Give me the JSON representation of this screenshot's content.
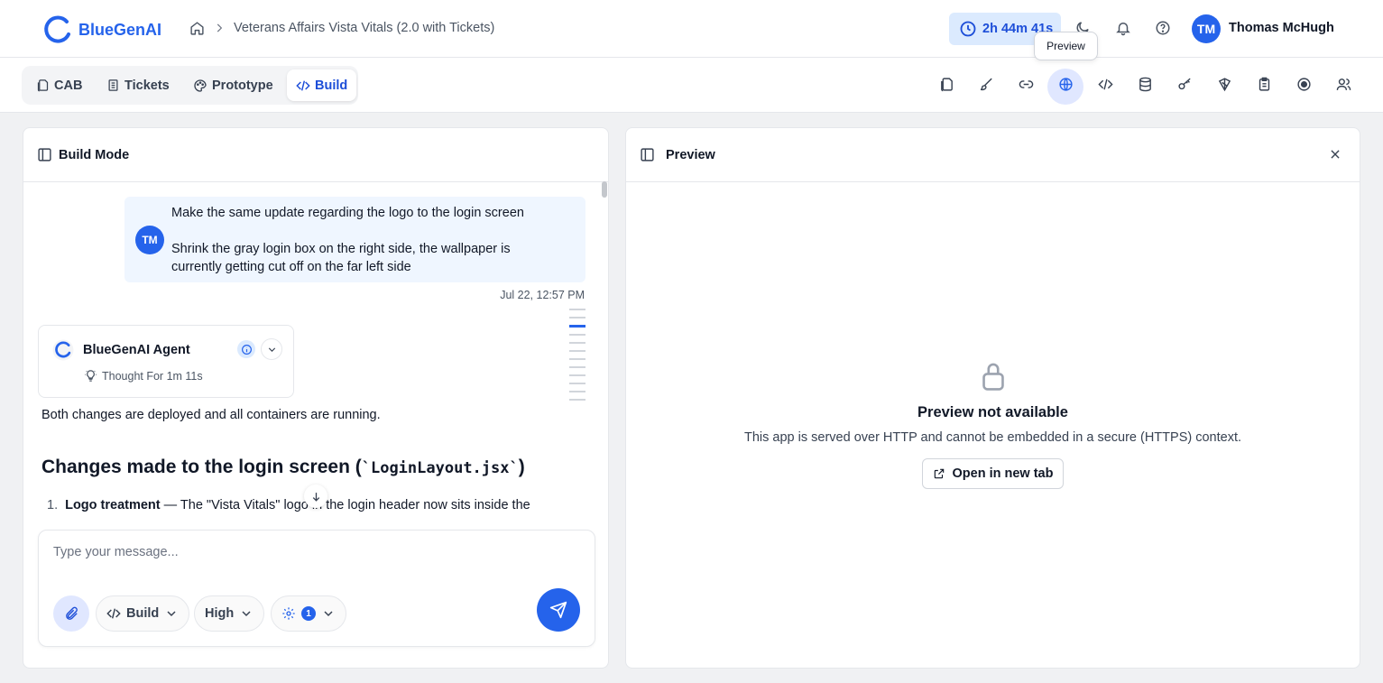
{
  "header": {
    "logo_text": "BlueGenAI",
    "breadcrumb_title": "Veterans Affairs Vista Vitals (2.0 with Tickets)",
    "timer": "2h 44m 41s",
    "tooltip": "Preview",
    "user_initials": "TM",
    "user_name": "Thomas McHugh"
  },
  "modes": {
    "cab": "CAB",
    "tickets": "Tickets",
    "prototype": "Prototype",
    "build": "Build",
    "active": "Build"
  },
  "toolbar_icons": [
    "document-icon",
    "brush-icon",
    "link-icon",
    "globe-icon",
    "code-icon",
    "database-icon",
    "key-icon",
    "shield-icon",
    "clipboard-icon",
    "record-icon",
    "users-icon"
  ],
  "left_panel": {
    "title": "Build Mode",
    "user_message": {
      "initials": "TM",
      "line1": "Make the same update regarding the logo to the login screen",
      "line2": "Shrink the gray login box on the right side, the wallpaper is",
      "line3": "currently getting cut off on the far left side",
      "timestamp": "Jul 22, 12:57 PM"
    },
    "agent": {
      "name": "BlueGenAI Agent",
      "thought": "Thought For 1m 11s"
    },
    "response": {
      "text": "Both changes are deployed and all containers are running.",
      "heading_prefix": "Changes made to the login screen (",
      "heading_code": "`LoginLayout.jsx`",
      "heading_suffix": ")",
      "list_number": "1.",
      "list_bold": "Logo treatment",
      "list_text": " — The \"Vista Vitals\" logo in the login header now sits inside the"
    },
    "composer": {
      "placeholder": "Type your message...",
      "mode": "Build",
      "effort": "High",
      "settings_count": "1"
    }
  },
  "right_panel": {
    "title": "Preview",
    "empty_title": "Preview not available",
    "empty_desc": "This app is served over HTTP and cannot be embedded in a secure (HTTPS) context.",
    "open_button": "Open in new tab"
  },
  "colors": {
    "brand": "#2563eb",
    "accent_bg": "#dbeafe",
    "user_bubble": "#eff6ff"
  }
}
